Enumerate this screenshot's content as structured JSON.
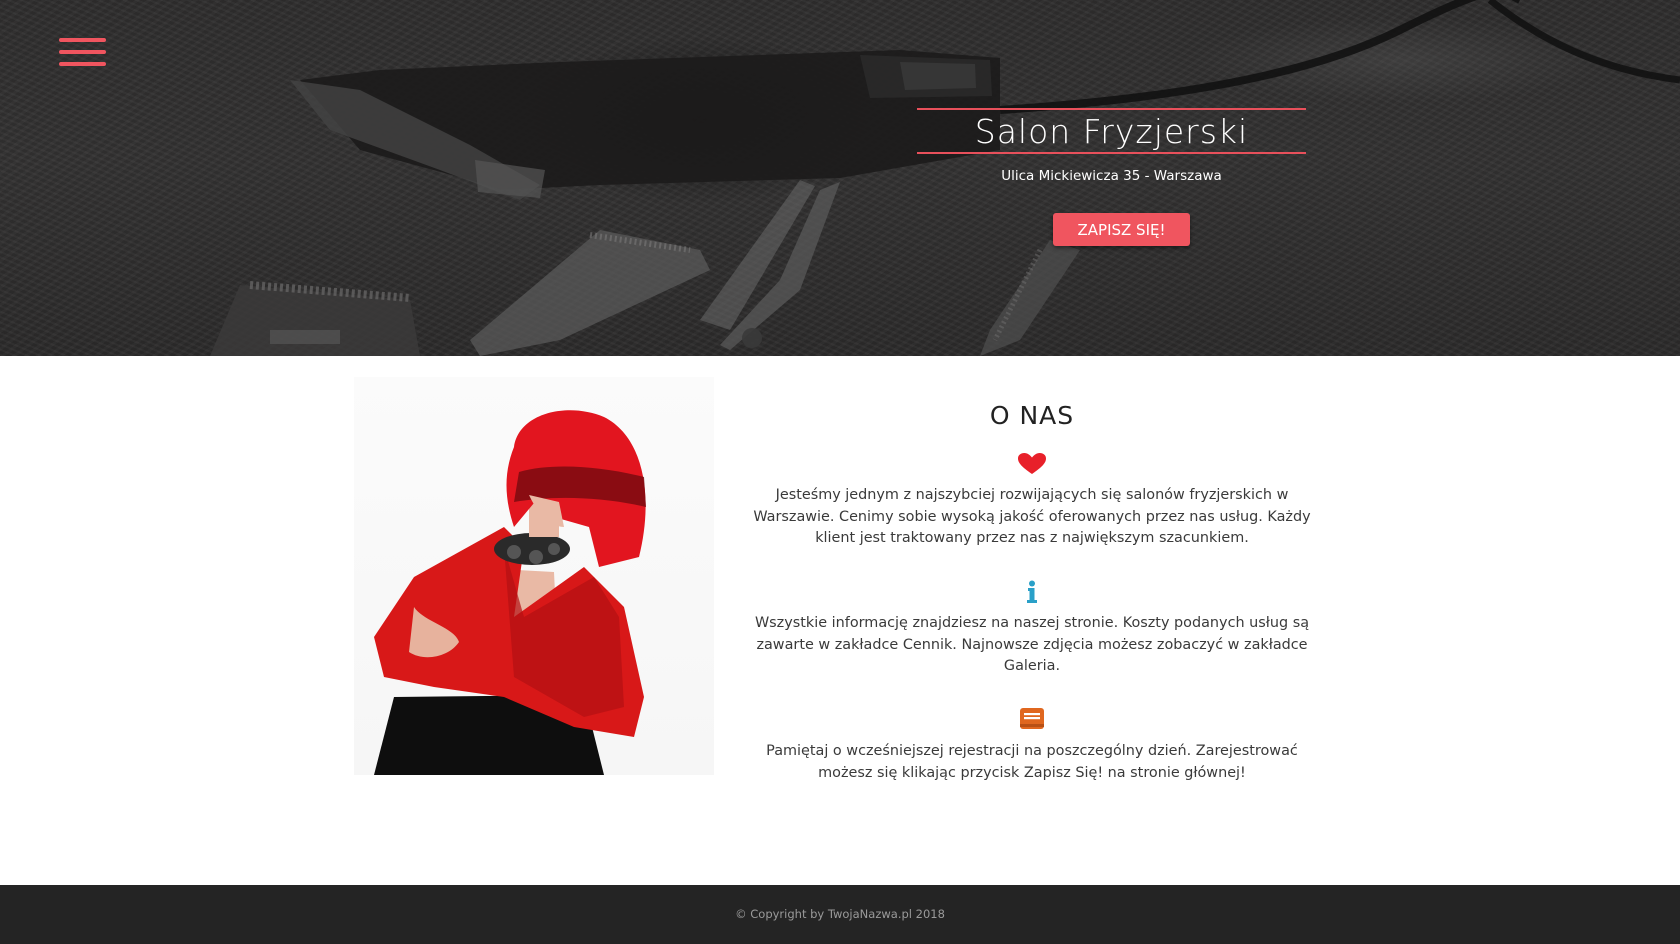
{
  "header": {
    "menu_icon": "hamburger-menu-icon",
    "accent_color": "#f0555f"
  },
  "hero": {
    "title": "Salon Fryzjerski",
    "address": "Ulica Mickiewicza 35 - Warszawa",
    "signup_label": "ZAPISZ SIĘ!"
  },
  "about": {
    "title": "O NAS",
    "blocks": [
      {
        "icon": "heart-icon",
        "icon_color": "#e8202a",
        "text": "Jesteśmy jednym z najszybciej rozwijających się salonów fryzjerskich w Warszawie. Cenimy sobie wysoką jakość oferowanych przez nas usług. Każdy klient jest traktowany przez nas z największym szacunkiem."
      },
      {
        "icon": "info-icon",
        "icon_color": "#2aa0c8",
        "text": "Wszystkie informację znajdziesz na naszej stronie. Koszty podanych usług są zawarte w zakładce Cennik. Najnowsze zdjęcia możesz zobaczyć w zakładce Galeria."
      },
      {
        "icon": "book-icon",
        "icon_color": "#e0671f",
        "text": "Pamiętaj o wcześniejszej rejestracji na poszczególny dzień. Zarejestrować możesz się klikając przycisk Zapisz Się! na stronie głównej!"
      }
    ]
  },
  "footer": {
    "copyright": "© Copyright by TwojaNazwa.pl 2018"
  }
}
